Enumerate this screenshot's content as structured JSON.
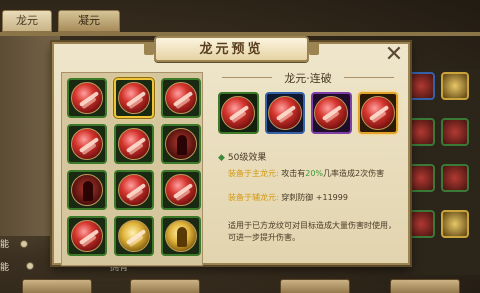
{
  "background": {
    "tabs": [
      "龙元",
      "凝元"
    ],
    "labels": [
      "能",
      "能",
      "拥有"
    ]
  },
  "modal": {
    "title": "龙元预览",
    "close_symbol": "✕",
    "set_title": "龙元·连破",
    "effect_heading": "50级效果",
    "effect_lines": [
      {
        "tag": "装备于主龙元:",
        "text_before": "攻击有",
        "highlight": "20%",
        "text_after": "几率造成2次伤害"
      },
      {
        "tag": "装备于辅龙元:",
        "text_before": "穿刺防御",
        "highlight": "",
        "text_after": " +11999"
      }
    ],
    "description": "适用于已方龙纹可对目标造成大量伤害时使用，可进一步提升伤害。"
  },
  "grid_icons": [
    {
      "name": "red-orb-icon",
      "style": "orb",
      "selected": false
    },
    {
      "name": "slash-orb-icon",
      "style": "orb",
      "selected": true
    },
    {
      "name": "slash-orb-icon",
      "style": "orb",
      "selected": false
    },
    {
      "name": "burst-orb-icon",
      "style": "orb",
      "selected": false
    },
    {
      "name": "slash-orb-icon",
      "style": "orb",
      "selected": false
    },
    {
      "name": "warrior-orb-icon",
      "style": "dark",
      "selected": false
    },
    {
      "name": "warrior-orb-icon",
      "style": "dark",
      "selected": false
    },
    {
      "name": "slash-orb-icon",
      "style": "orb",
      "selected": false
    },
    {
      "name": "slash-orb-icon",
      "style": "orb",
      "selected": false
    },
    {
      "name": "slash-orb-icon",
      "style": "orb",
      "selected": false
    },
    {
      "name": "gold-orb-icon",
      "style": "gold",
      "selected": false
    },
    {
      "name": "gold-figure-orb-icon",
      "style": "gold",
      "selected": false
    }
  ],
  "set_slots": [
    {
      "border": "green",
      "name": "slash-orb-icon"
    },
    {
      "border": "blue",
      "name": "slash-orb-icon"
    },
    {
      "border": "purple",
      "name": "slash-orb-icon"
    },
    {
      "border": "orange",
      "name": "slash-orb-icon"
    }
  ],
  "colors": {
    "frame": "#9c8352",
    "panel": "#efe6cc",
    "highlight_yellow": "#d49a14",
    "highlight_green": "#3c9a3a"
  }
}
